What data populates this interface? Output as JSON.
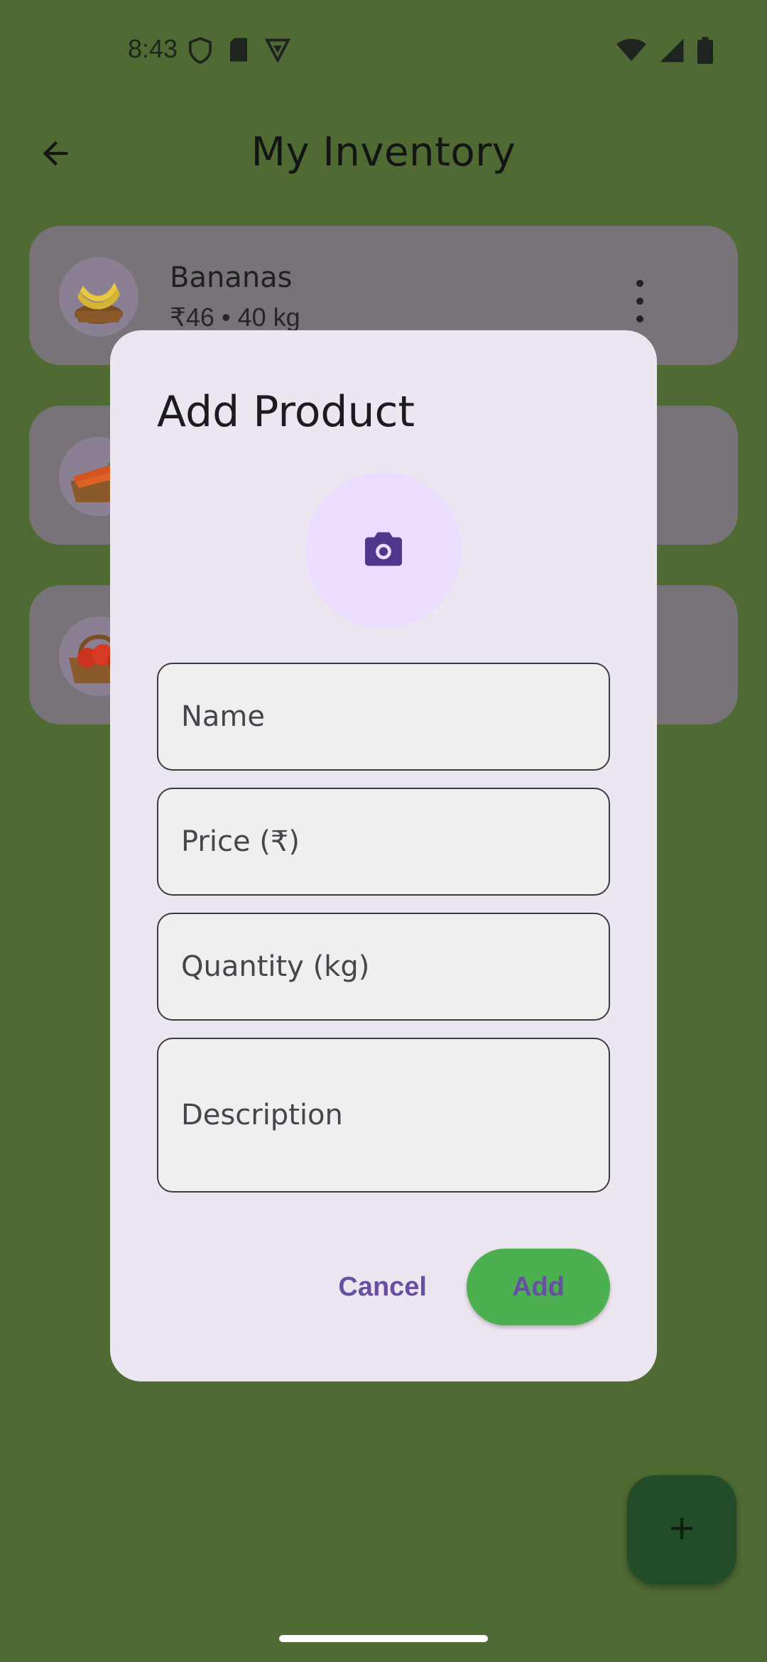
{
  "status_bar": {
    "time": "8:43",
    "left_icons": [
      "shield-icon",
      "sd-card-icon",
      "vpn-key-icon"
    ],
    "right_icons": [
      "wifi-icon",
      "signal-icon",
      "battery-icon"
    ]
  },
  "app_bar": {
    "title": "My Inventory",
    "back_icon": "arrow-back-icon"
  },
  "products": [
    {
      "name": "Bananas",
      "subtitle": "₹46 • 40 kg",
      "image": "bananas-basket"
    },
    {
      "name": "",
      "subtitle": "",
      "image": "carrots-basket"
    },
    {
      "name": "",
      "subtitle": "",
      "image": "tomatoes-basket"
    }
  ],
  "dialog": {
    "title": "Add Product",
    "photo_icon": "camera-icon",
    "fields": {
      "name": {
        "placeholder": "Name",
        "value": ""
      },
      "price": {
        "placeholder": "Price (₹)",
        "value": ""
      },
      "quantity": {
        "placeholder": "Quantity (kg)",
        "value": ""
      },
      "description": {
        "placeholder": "Description",
        "value": ""
      }
    },
    "actions": {
      "cancel": "Cancel",
      "add": "Add"
    }
  },
  "fab": {
    "icon": "add-icon"
  },
  "colors": {
    "background": "#4f6b33",
    "dialog_surface": "#ece6f0",
    "primary": "#6750a4",
    "add_button": "#4caf50",
    "fab": "#234c28"
  }
}
